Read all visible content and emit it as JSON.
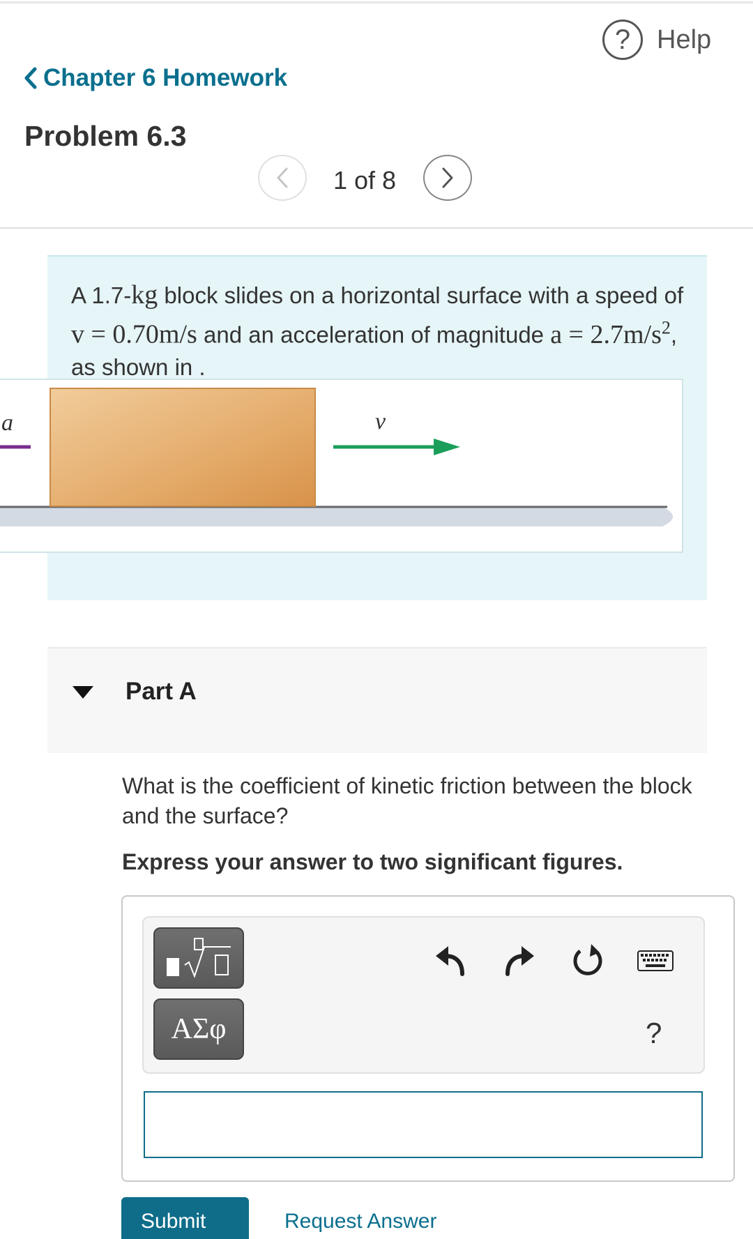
{
  "nav": {
    "help_label": "Help",
    "help_icon": "?",
    "back_label": "Chapter 6 Homework"
  },
  "problem": {
    "title": "Problem 6.3",
    "pager": "1 of 8",
    "statement": {
      "part1": "A 1.7-",
      "unit_kg": "kg",
      "part2": " block slides on a horizontal surface with a speed of ",
      "v_eq": "v = 0.70m/s",
      "part3": " and an acceleration of magnitude ",
      "a_eq": "a = 2.7m/s",
      "a_exp": "2",
      "part4": ", as shown in ."
    },
    "figure": {
      "accel_label": "a",
      "velocity_label": "v",
      "accel_color": "#7a2c8f",
      "velocity_color": "#1a9e5a",
      "block_color": "#e2a866"
    }
  },
  "partA": {
    "title": "Part A",
    "question": "What is the coefficient of kinetic friction between the block and the surface?",
    "instruction": "Express your answer to two significant figures.",
    "greek_button": "ΑΣφ",
    "help_symbol": "?",
    "answer_value": "",
    "submit_label": "Submit",
    "request_label": "Request Answer"
  },
  "colors": {
    "link": "#0a6f8e",
    "panel_bg": "#e6f5f7",
    "submit_bg": "#0f6d8a"
  }
}
